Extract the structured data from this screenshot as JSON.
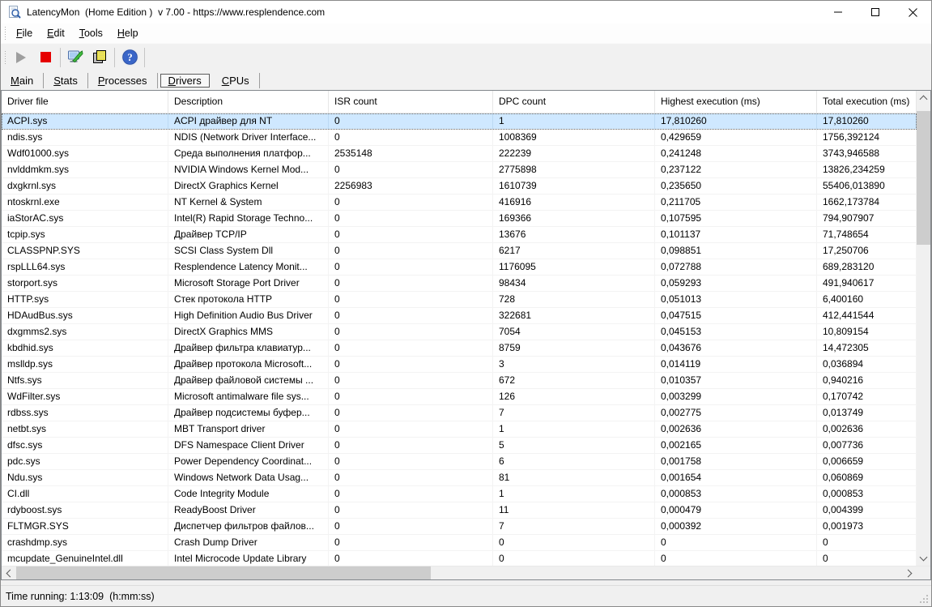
{
  "window": {
    "title": "LatencyMon  (Home Edition )  v 7.00 - https://www.resplendence.com"
  },
  "menu": {
    "items": [
      "File",
      "Edit",
      "Tools",
      "Help"
    ]
  },
  "toolbar": {
    "buttons": [
      {
        "name": "start-monitor",
        "icon": "play-icon",
        "enabled": false
      },
      {
        "name": "stop-monitor",
        "icon": "stop-icon",
        "enabled": true
      },
      {
        "name": "report-options",
        "icon": "monitor-tool-icon",
        "enabled": true
      },
      {
        "name": "copy-report",
        "icon": "copy-icon",
        "enabled": true
      },
      {
        "name": "help",
        "icon": "help-icon",
        "enabled": true
      }
    ]
  },
  "tabs": [
    {
      "label": "Main",
      "selected": false
    },
    {
      "label": "Stats",
      "selected": false
    },
    {
      "label": "Processes",
      "selected": false
    },
    {
      "label": "Drivers",
      "selected": true
    },
    {
      "label": "CPUs",
      "selected": false
    }
  ],
  "active_tab": "Drivers",
  "table": {
    "columns": [
      "Driver file",
      "Description",
      "ISR count",
      "DPC count",
      "Highest execution (ms)",
      "Total execution (ms)"
    ],
    "selected_row_index": 0,
    "rows": [
      [
        "ACPI.sys",
        "ACPI драйвер для NT",
        "0",
        "1",
        "17,810260",
        "17,810260"
      ],
      [
        "ndis.sys",
        "NDIS (Network Driver Interface...",
        "0",
        "1008369",
        "0,429659",
        "1756,392124"
      ],
      [
        "Wdf01000.sys",
        "Среда выполнения платфор...",
        "2535148",
        "222239",
        "0,241248",
        "3743,946588"
      ],
      [
        "nvlddmkm.sys",
        "NVIDIA Windows Kernel Mod...",
        "0",
        "2775898",
        "0,237122",
        "13826,234259"
      ],
      [
        "dxgkrnl.sys",
        "DirectX Graphics Kernel",
        "2256983",
        "1610739",
        "0,235650",
        "55406,013890"
      ],
      [
        "ntoskrnl.exe",
        "NT Kernel & System",
        "0",
        "416916",
        "0,211705",
        "1662,173784"
      ],
      [
        "iaStorAC.sys",
        "Intel(R) Rapid Storage Techno...",
        "0",
        "169366",
        "0,107595",
        "794,907907"
      ],
      [
        "tcpip.sys",
        "Драйвер TCP/IP",
        "0",
        "13676",
        "0,101137",
        "71,748654"
      ],
      [
        "CLASSPNP.SYS",
        "SCSI Class System Dll",
        "0",
        "6217",
        "0,098851",
        "17,250706"
      ],
      [
        "rspLLL64.sys",
        "Resplendence Latency Monit...",
        "0",
        "1176095",
        "0,072788",
        "689,283120"
      ],
      [
        "storport.sys",
        "Microsoft Storage Port Driver",
        "0",
        "98434",
        "0,059293",
        "491,940617"
      ],
      [
        "HTTP.sys",
        "Стек протокола HTTP",
        "0",
        "728",
        "0,051013",
        "6,400160"
      ],
      [
        "HDAudBus.sys",
        "High Definition Audio Bus Driver",
        "0",
        "322681",
        "0,047515",
        "412,441544"
      ],
      [
        "dxgmms2.sys",
        "DirectX Graphics MMS",
        "0",
        "7054",
        "0,045153",
        "10,809154"
      ],
      [
        "kbdhid.sys",
        "Драйвер фильтра клавиатур...",
        "0",
        "8759",
        "0,043676",
        "14,472305"
      ],
      [
        "mslldp.sys",
        "Драйвер протокола Microsoft...",
        "0",
        "3",
        "0,014119",
        "0,036894"
      ],
      [
        "Ntfs.sys",
        "Драйвер файловой системы ...",
        "0",
        "672",
        "0,010357",
        "0,940216"
      ],
      [
        "WdFilter.sys",
        "Microsoft antimalware file sys...",
        "0",
        "126",
        "0,003299",
        "0,170742"
      ],
      [
        "rdbss.sys",
        "Драйвер подсистемы буфер...",
        "0",
        "7",
        "0,002775",
        "0,013749"
      ],
      [
        "netbt.sys",
        "MBT Transport driver",
        "0",
        "1",
        "0,002636",
        "0,002636"
      ],
      [
        "dfsc.sys",
        "DFS Namespace Client Driver",
        "0",
        "5",
        "0,002165",
        "0,007736"
      ],
      [
        "pdc.sys",
        "Power Dependency Coordinat...",
        "0",
        "6",
        "0,001758",
        "0,006659"
      ],
      [
        "Ndu.sys",
        "Windows Network Data Usag...",
        "0",
        "81",
        "0,001654",
        "0,060869"
      ],
      [
        "CI.dll",
        "Code Integrity Module",
        "0",
        "1",
        "0,000853",
        "0,000853"
      ],
      [
        "rdyboost.sys",
        "ReadyBoost Driver",
        "0",
        "11",
        "0,000479",
        "0,004399"
      ],
      [
        "FLTMGR.SYS",
        "Диспетчер фильтров файлов...",
        "0",
        "7",
        "0,000392",
        "0,001973"
      ],
      [
        "crashdmp.sys",
        "Crash Dump Driver",
        "0",
        "0",
        "0",
        "0"
      ],
      [
        "mcupdate_GenuineIntel.dll",
        "Intel Microcode Update Library",
        "0",
        "0",
        "0",
        "0"
      ]
    ]
  },
  "status_bar": {
    "text": "Time running: 1:13:09  (h:mm:ss)"
  },
  "colors": {
    "selection_highlight": "#cfe8ff",
    "stop_button": "#e60000",
    "help_icon": "#3a66c8",
    "copy_icon": "#f2ea49"
  }
}
